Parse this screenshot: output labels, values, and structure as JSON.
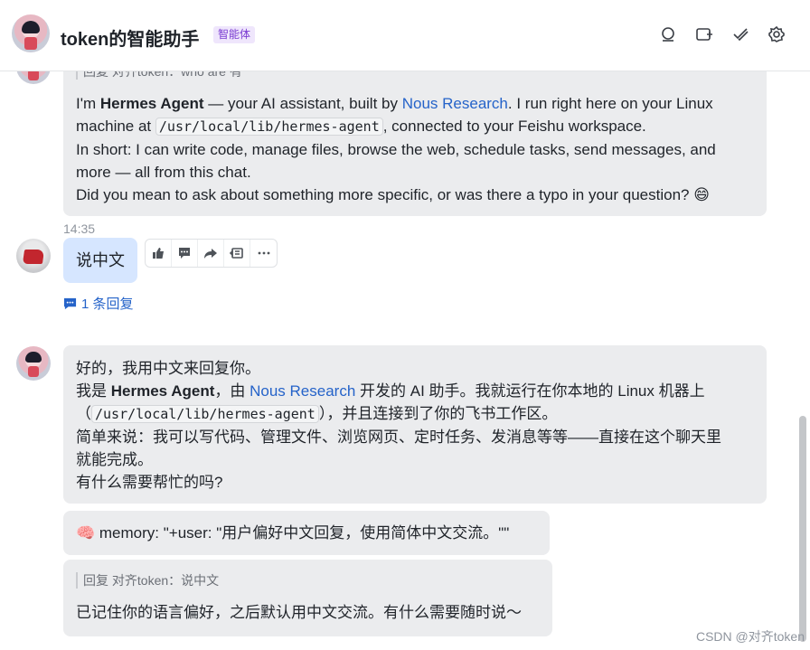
{
  "header": {
    "title": "token的智能助手",
    "badge": "智能体",
    "icons": [
      "search-icon",
      "add-tab-icon",
      "checkmark-icon",
      "settings-icon"
    ]
  },
  "messages": {
    "first": {
      "quote": "回复 对齐token：who are 有",
      "intro_pre": "I'm ",
      "name": "Hermes Agent",
      "intro_mid": " — your AI assistant, built by ",
      "link": "Nous Research",
      "intro_post": ". I run right here on your Linux",
      "line2_pre": "machine at ",
      "path": "/usr/local/lib/hermes-agent",
      "line2_post": ", connected to your Feishu workspace.",
      "line3": "In short: I can write code, manage files, browse the web, schedule tasks, send messages, and",
      "line4": "more — all from this chat.",
      "line5": "Did you mean to ask about something more specific, or was there a typo in your question? 😄"
    },
    "user": {
      "time": "14:35",
      "text": "说中文",
      "reply_count": "1 条回复"
    },
    "second": {
      "line1": "好的，我用中文来回复你。",
      "line2_pre": "我是 ",
      "name": "Hermes Agent",
      "line2_mid": "，由 ",
      "link": "Nous Research",
      "line2_post": " 开发的 AI 助手。我就运行在你本地的 Linux 机器上",
      "line3_pre": "（",
      "path": "/usr/local/lib/hermes-agent",
      "line3_post": "），并且连接到了你的飞书工作区。",
      "line4": "简单来说：我可以写代码、管理文件、浏览网页、定时任务、发消息等等——直接在这个聊天里",
      "line5": "就能完成。",
      "line6": "有什么需要帮忙的吗?"
    },
    "memory": {
      "emoji": "🧠",
      "text": " memory: \"+user: \"用户偏好中文回复，使用简体中文交流。\"\""
    },
    "reply": {
      "quote": "回复 对齐token：说中文",
      "text": "已记住你的语言偏好，之后默认用中文交流。有什么需要随时说～"
    }
  },
  "watermark": "CSDN @对齐token"
}
